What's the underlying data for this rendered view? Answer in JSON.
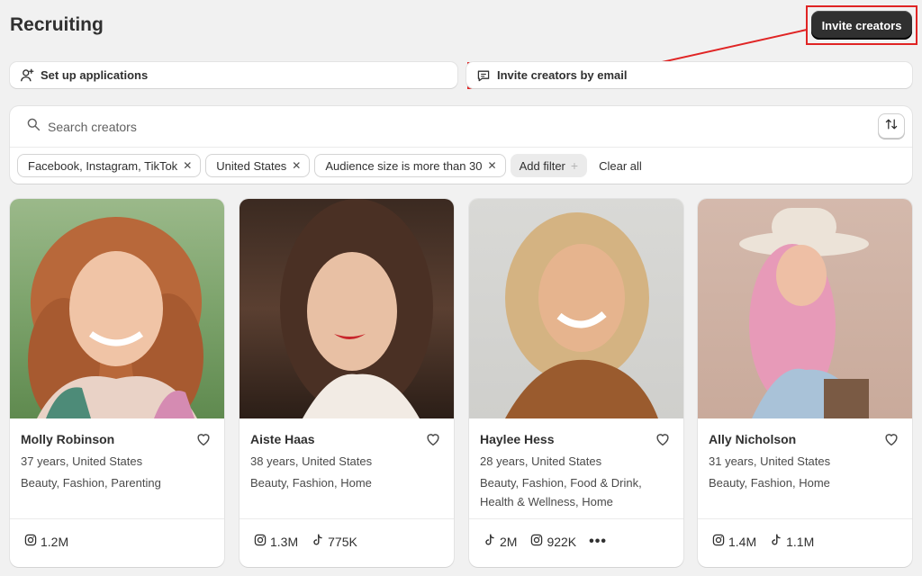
{
  "header": {
    "title": "Recruiting",
    "invite_button": "Invite creators"
  },
  "actions": {
    "setup": "Set up applications",
    "invite_email": "Invite creators by email"
  },
  "search": {
    "placeholder": "Search creators"
  },
  "filters": {
    "chips": [
      "Facebook, Instagram, TikTok",
      "United States",
      "Audience size is more than 30"
    ],
    "add_filter": "Add filter",
    "clear_all": "Clear all"
  },
  "creators": [
    {
      "name": "Molly Robinson",
      "age_location": "37 years, United States",
      "categories": "Beauty, Fashion, Parenting",
      "stats": [
        {
          "platform": "instagram-icon",
          "value": "1.2M"
        }
      ]
    },
    {
      "name": "Aiste Haas",
      "age_location": "38 years, United States",
      "categories": "Beauty, Fashion, Home",
      "stats": [
        {
          "platform": "instagram-icon",
          "value": "1.3M"
        },
        {
          "platform": "tiktok-icon",
          "value": "775K"
        }
      ]
    },
    {
      "name": "Haylee Hess",
      "age_location": "28 years, United States",
      "categories": "Beauty, Fashion, Food & Drink, Health & Wellness, Home",
      "stats": [
        {
          "platform": "tiktok-icon",
          "value": "2M"
        },
        {
          "platform": "instagram-icon",
          "value": "922K"
        }
      ],
      "more": "•••"
    },
    {
      "name": "Ally Nicholson",
      "age_location": "31 years, United States",
      "categories": "Beauty, Fashion, Home",
      "stats": [
        {
          "platform": "instagram-icon",
          "value": "1.4M"
        },
        {
          "platform": "tiktok-icon",
          "value": "1.1M"
        }
      ]
    }
  ],
  "colors": {
    "accent_dark": "#303030",
    "highlight": "#e02424",
    "background": "#f1f1f1"
  }
}
